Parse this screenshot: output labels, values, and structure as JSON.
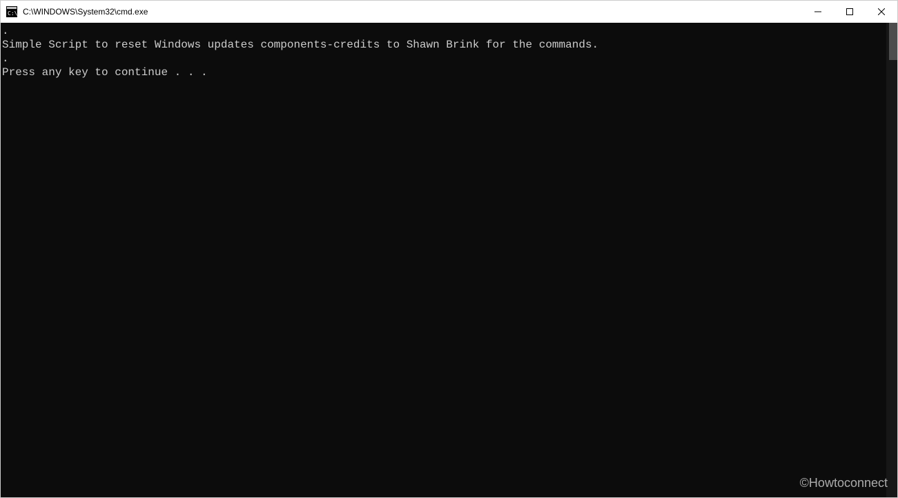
{
  "window": {
    "title": "C:\\WINDOWS\\System32\\cmd.exe"
  },
  "terminal": {
    "lines": [
      ".",
      "Simple Script to reset Windows updates components-credits to Shawn Brink for the commands.",
      ".",
      "Press any key to continue . . ."
    ]
  },
  "watermark": "©Howtoconnect"
}
